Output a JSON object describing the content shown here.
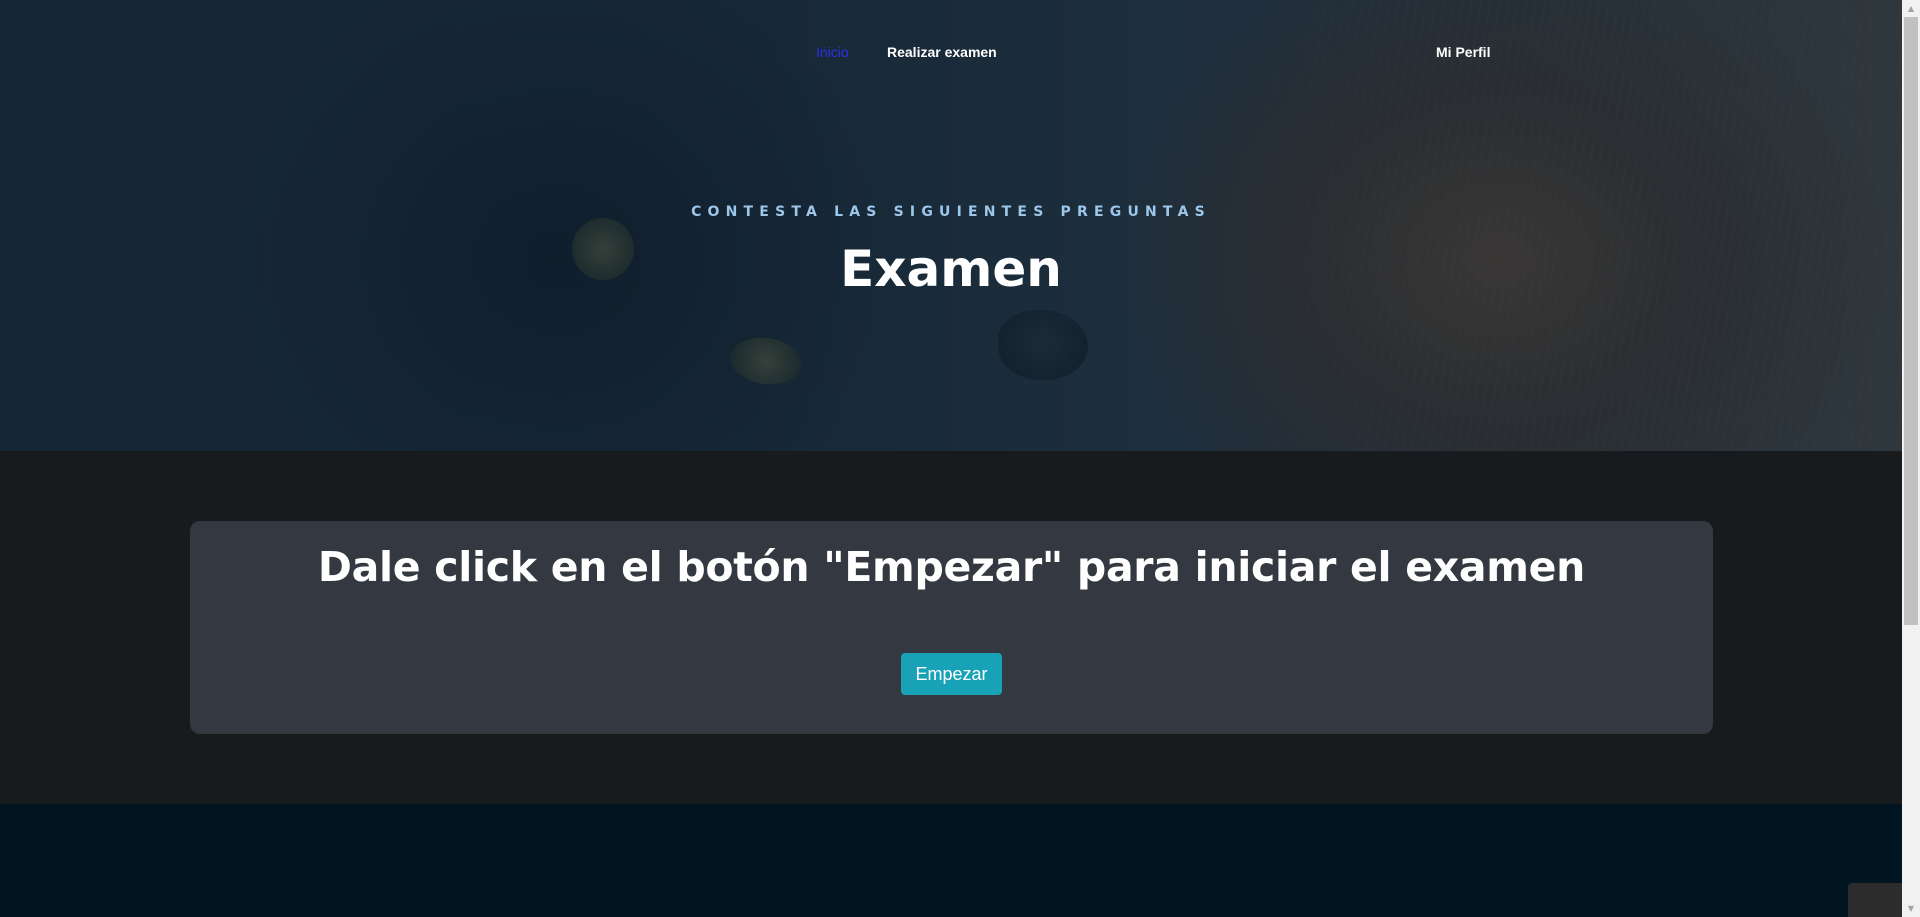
{
  "nav": {
    "home": "Inicio",
    "take_exam": "Realizar examen",
    "profile": "Mi Perfil"
  },
  "hero": {
    "subtitle": "CONTESTA LAS SIGUIENTES PREGUNTAS",
    "title": "Examen"
  },
  "main": {
    "heading": "Dale click en el botón \"Empezar\" para iniciar el examen",
    "start_button": "Empezar"
  },
  "scrollbar": {
    "up_icon": "triangle-up",
    "down_icon": "triangle-down"
  },
  "colors": {
    "active_nav": "#2f2fe8",
    "subtitle": "#9cc6ea",
    "card_bg": "#343841",
    "button_bg": "#17a2b8",
    "page_bg": "#181b1e",
    "footer_bg": "#011521"
  }
}
